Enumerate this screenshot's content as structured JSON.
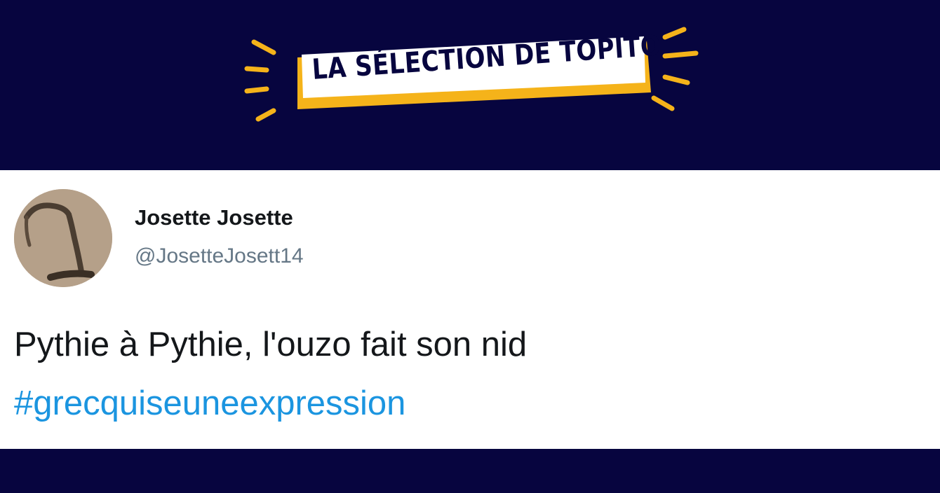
{
  "banner": {
    "title": "LA SÉLECTION DE TOPITO"
  },
  "colors": {
    "navy": "#07053f",
    "accent": "#f5b31a",
    "link": "#1b95e0",
    "text": "#14171a",
    "muted": "#657786"
  },
  "tweet": {
    "author_name": "Josette Josette",
    "author_handle": "@JosetteJosett14",
    "text": "Pythie à Pythie, l'ouzo fait son nid",
    "hashtag": "#grecquiseuneexpression",
    "avatar_icon": "avatar-photo"
  }
}
